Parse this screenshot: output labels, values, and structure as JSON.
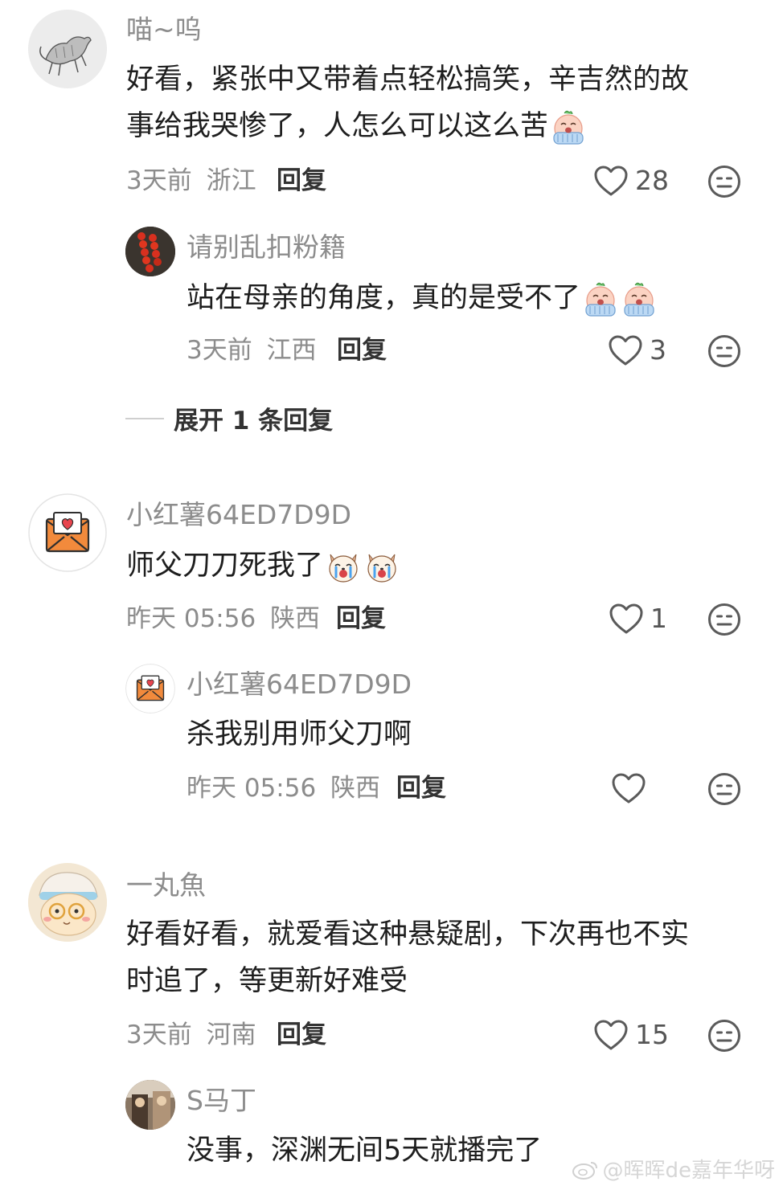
{
  "comments": [
    {
      "username": "喵~呜",
      "text_line1": "好看，紧张中又带着点轻松搞笑，辛吉然的故",
      "text_line2": "事给我哭惨了，人怎么可以这么苦",
      "time": "3天前",
      "location": "浙江",
      "reply_label": "回复",
      "likes": "28",
      "avatar_icon": "cat-sketch-avatar",
      "emoji_icon": "crying-egg-emoji",
      "replies": [
        {
          "username": "请别乱扣粉籍",
          "text": "站在母亲的角度，真的是受不了",
          "time": "3天前",
          "location": "江西",
          "reply_label": "回复",
          "likes": "3",
          "avatar_icon": "red-beads-avatar",
          "emoji_icon": "crying-egg-emoji"
        }
      ],
      "expand_label": "展开 1 条回复"
    },
    {
      "username": "小红薯64ED7D9D",
      "text": "师父刀刀死我了",
      "time": "昨天 05:56",
      "location": "陕西",
      "reply_label": "回复",
      "likes": "1",
      "avatar_icon": "envelope-heart-avatar",
      "emoji_icon": "crying-dog-emoji",
      "replies": [
        {
          "username": "小红薯64ED7D9D",
          "text": "杀我别用师父刀啊",
          "time": "昨天 05:56",
          "location": "陕西",
          "reply_label": "回复",
          "avatar_icon": "envelope-heart-avatar"
        }
      ]
    },
    {
      "username": "一丸魚",
      "text_line1": "好看好看，就爱看这种悬疑剧，下次再也不实",
      "text_line2": "时追了，等更新好难受",
      "time": "3天前",
      "location": "河南",
      "reply_label": "回复",
      "likes": "15",
      "avatar_icon": "cartoon-bear-avatar",
      "replies": [
        {
          "username": "S马丁",
          "text": "没事，深渊无间5天就播完了",
          "avatar_icon": "photo-avatar"
        }
      ]
    }
  ],
  "watermark": "@晖晖de嘉年华呀",
  "colors": {
    "username": "#8c8c8c",
    "text": "#1e1e1e",
    "meta": "#8c8c8c",
    "accent_orange": "#f28a3c"
  }
}
